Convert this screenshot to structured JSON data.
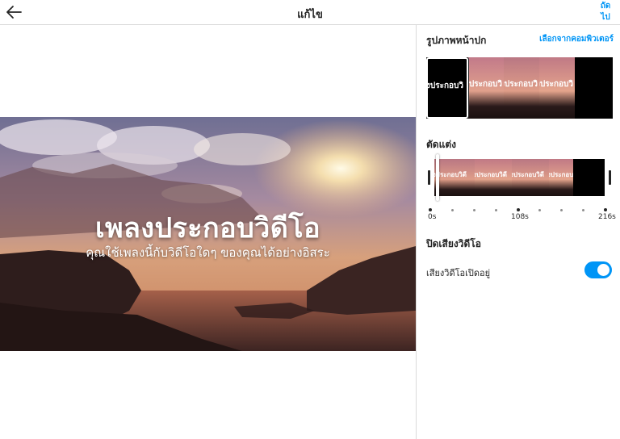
{
  "header": {
    "title": "แก้ไข",
    "next_label": "ถัดไป",
    "back_icon": "arrow-left-icon"
  },
  "preview": {
    "title": "เพลงประกอบวิดีโอ",
    "subtitle": "คุณใช้เพลงนี้กับวิดีโอใดๆ ของคุณได้อย่างอิสระ"
  },
  "cover": {
    "label": "รูปภาพหน้าปก",
    "from_computer_label": "เลือกจากคอมพิวเตอร์",
    "thumb_text": "งประกอบวิ"
  },
  "trim": {
    "label": "ตัดแต่ง",
    "thumb_text": "งประกอบวิดี",
    "tick_labels": [
      "0s",
      "108s",
      "216s"
    ]
  },
  "audio": {
    "label": "ปิดเสียงวิดีโอ",
    "toggle_label": "เสียงวิดีโอเปิดอยู่",
    "toggle_on": true,
    "accent_color": "#0095f6"
  }
}
